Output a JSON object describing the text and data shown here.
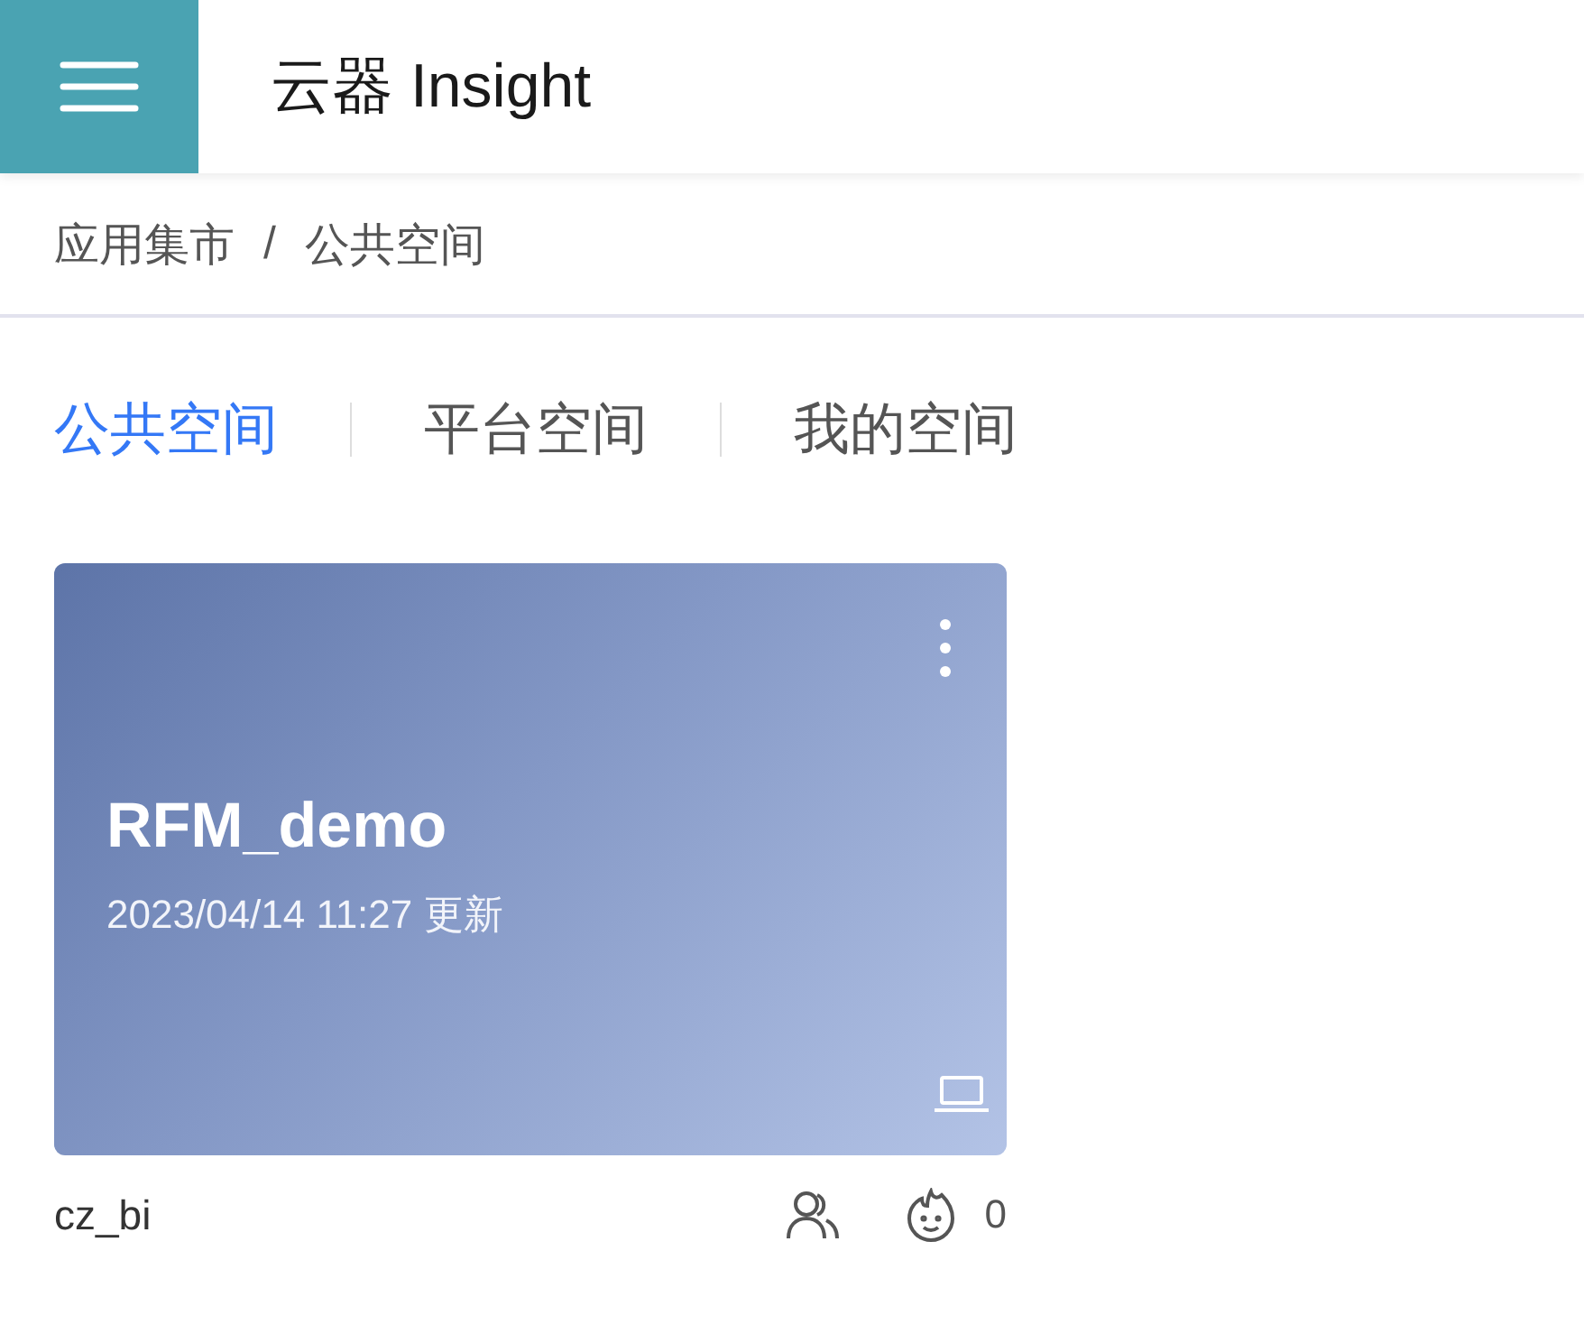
{
  "header": {
    "title": "云器 Insight"
  },
  "breadcrumb": {
    "items": [
      "应用集市",
      "公共空间"
    ],
    "separator": "/"
  },
  "tabs": [
    {
      "label": "公共空间",
      "selected": true
    },
    {
      "label": "平台空间",
      "selected": false
    },
    {
      "label": "我的空间",
      "selected": false
    }
  ],
  "cards": [
    {
      "title": "RFM_demo",
      "updated": "2023/04/14 11:27 更新",
      "author": "cz_bi",
      "likes": "0"
    }
  ]
}
